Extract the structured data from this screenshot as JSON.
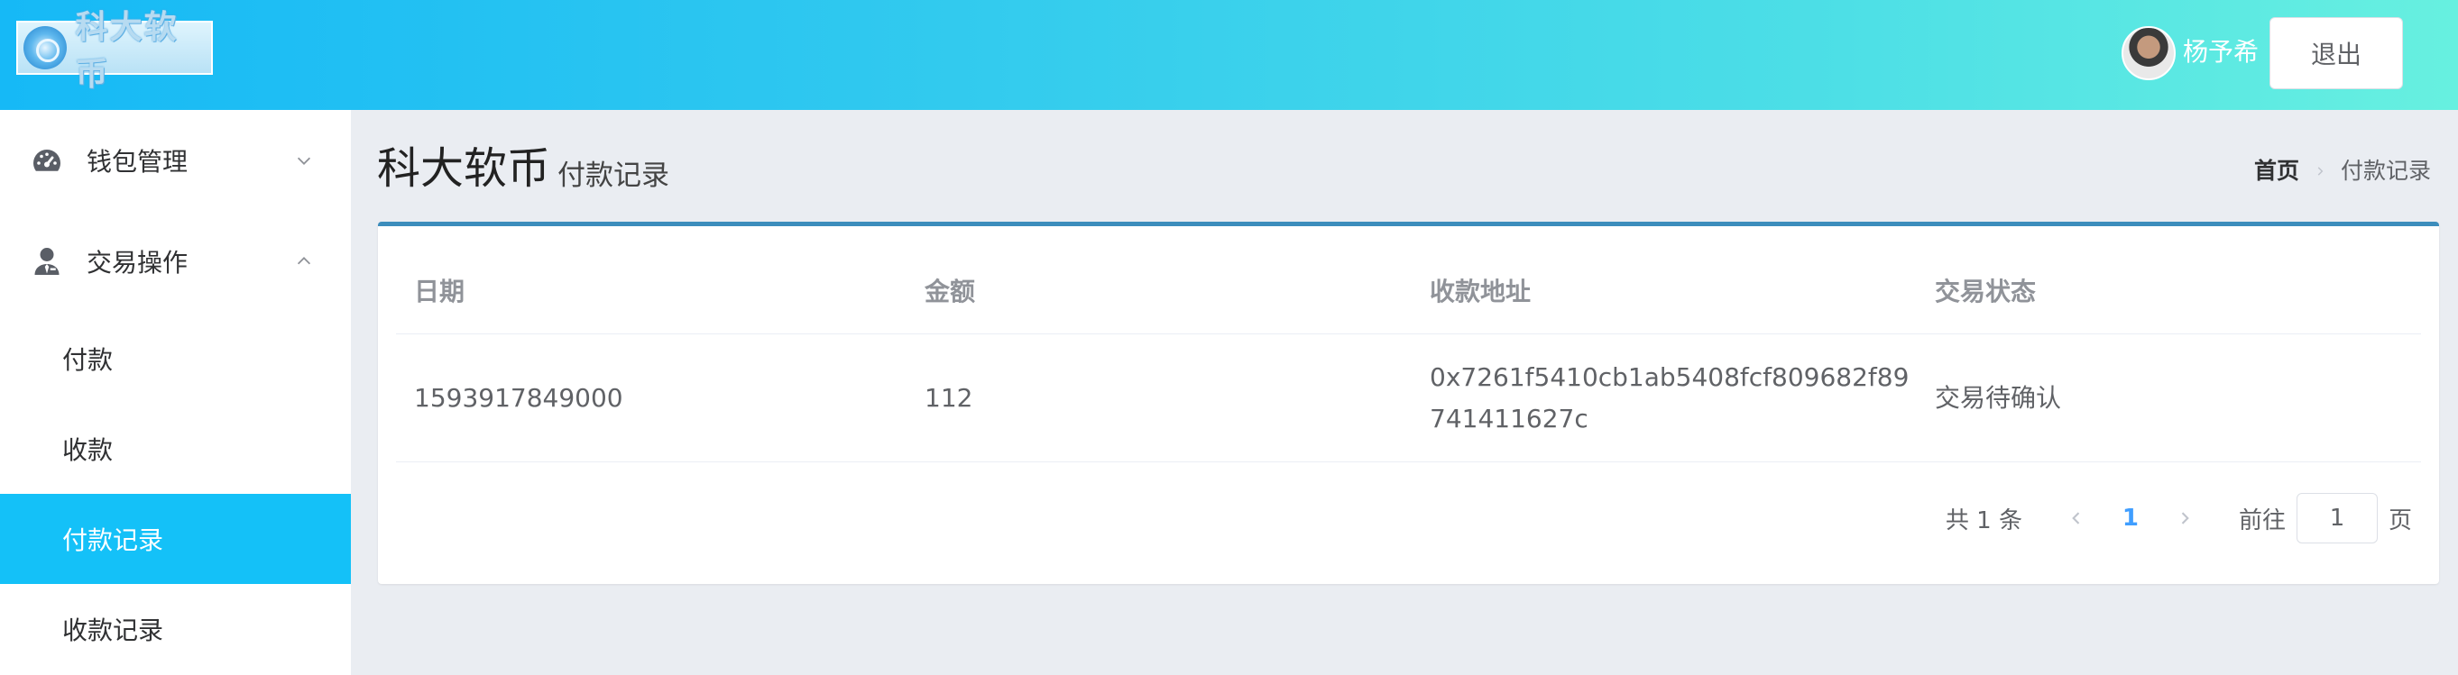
{
  "header": {
    "logo_text": "科大软币",
    "username": "杨予希",
    "logout_label": "退出"
  },
  "sidebar": {
    "groups": [
      {
        "label": "钱包管理",
        "icon": "dashboard-gauge-icon",
        "expanded": false
      },
      {
        "label": "交易操作",
        "icon": "user-tie-icon",
        "expanded": true
      }
    ],
    "items": [
      {
        "label": "付款",
        "active": false
      },
      {
        "label": "收款",
        "active": false
      },
      {
        "label": "付款记录",
        "active": true
      },
      {
        "label": "收款记录",
        "active": false
      }
    ],
    "active_color": "#14c1f8"
  },
  "page": {
    "title": "科大软币",
    "subtitle": "付款记录"
  },
  "breadcrumb": {
    "home": "首页",
    "current": "付款记录"
  },
  "table": {
    "headers": [
      "日期",
      "金额",
      "收款地址",
      "交易状态"
    ],
    "rows": [
      {
        "date": "1593917849000",
        "amount": "112",
        "address": "0x7261f5410cb1ab5408fcf809682f89741411627c",
        "status": "交易待确认"
      }
    ]
  },
  "pagination": {
    "total_text": "共 1 条",
    "current_page": "1",
    "goto_prefix": "前往",
    "goto_value": "1",
    "goto_suffix": "页"
  },
  "colors": {
    "header_gradient_start": "#16b9f6",
    "header_gradient_end": "#67f0e0",
    "card_top_border": "#3c8dbc",
    "page_active": "#409eff"
  }
}
